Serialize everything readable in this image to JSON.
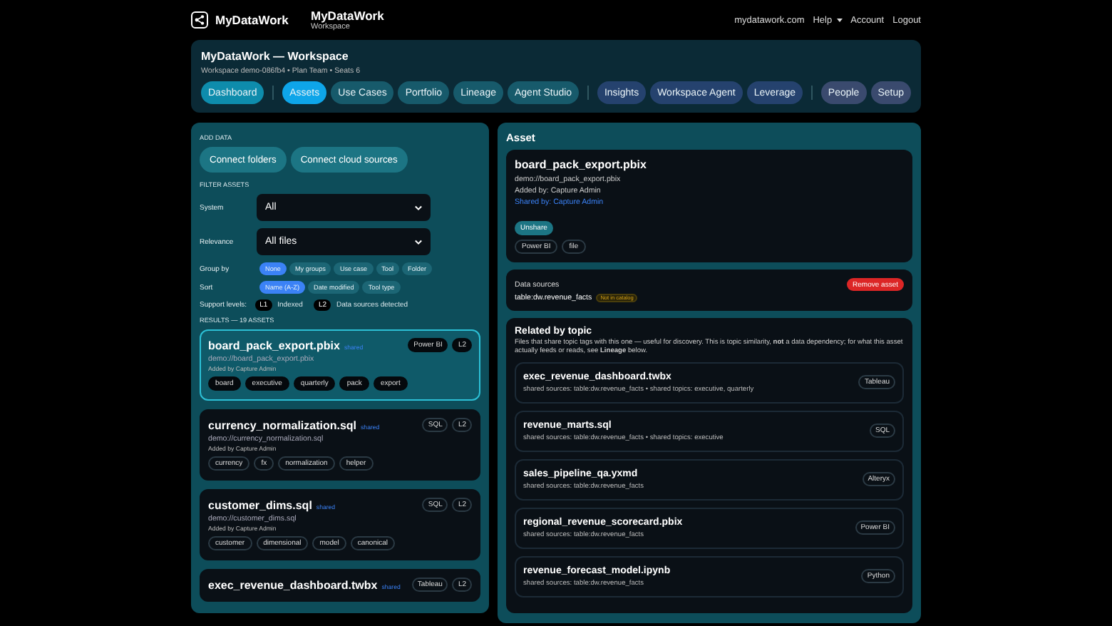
{
  "header": {
    "brand": "MyDataWork",
    "title": "MyDataWork",
    "subtitle": "Workspace",
    "links": [
      {
        "label": "mydatawork.com",
        "menu": false
      },
      {
        "label": "Help",
        "menu": true
      },
      {
        "label": "Account",
        "menu": false
      },
      {
        "label": "Logout",
        "menu": false
      }
    ]
  },
  "workspace": {
    "title": "MyDataWork — Workspace",
    "meta": "Workspace demo-086fb4 • Plan Team • Seats 6",
    "nav_groups": [
      {
        "kind": "home",
        "tabs": [
          {
            "label": "Dashboard",
            "selected": false
          }
        ]
      },
      {
        "kind": "build",
        "tabs": [
          {
            "label": "Assets",
            "selected": true
          },
          {
            "label": "Use Cases",
            "selected": false
          },
          {
            "label": "Portfolio",
            "selected": false
          },
          {
            "label": "Lineage",
            "selected": false
          },
          {
            "label": "Agent Studio",
            "selected": false
          }
        ]
      },
      {
        "kind": "analyze",
        "tabs": [
          {
            "label": "Insights",
            "selected": false
          },
          {
            "label": "Workspace Agent",
            "selected": false
          },
          {
            "label": "Leverage",
            "selected": false
          }
        ]
      },
      {
        "kind": "admin",
        "tabs": [
          {
            "label": "People",
            "selected": false
          },
          {
            "label": "Setup",
            "selected": false
          }
        ]
      }
    ]
  },
  "filters": {
    "add_heading": "ADD DATA",
    "add_buttons": [
      "Connect folders",
      "Connect cloud sources"
    ],
    "filter_heading": "FILTER ASSETS",
    "selects": [
      {
        "label": "System",
        "value": "All"
      },
      {
        "label": "Relevance",
        "value": "All files"
      }
    ],
    "group_by": {
      "label": "Group by",
      "options": [
        {
          "label": "None",
          "selected": true
        },
        {
          "label": "My groups",
          "selected": false
        },
        {
          "label": "Use case",
          "selected": false
        },
        {
          "label": "Tool",
          "selected": false
        },
        {
          "label": "Folder",
          "selected": false
        }
      ]
    },
    "sort": {
      "label": "Sort",
      "options": [
        {
          "label": "Name (A-Z)",
          "selected": true
        },
        {
          "label": "Date modified",
          "selected": false
        },
        {
          "label": "Tool type",
          "selected": false
        }
      ]
    },
    "support": {
      "label": "Support levels:",
      "levels": [
        {
          "badge": "L1",
          "text": "Indexed"
        },
        {
          "badge": "L2",
          "text": "Data sources detected"
        }
      ]
    },
    "results_heading": "RESULTS — 19 ASSETS"
  },
  "results": [
    {
      "name": "board_pack_export.pbix",
      "shared": "shared",
      "tool": "Power BI",
      "level": "L2",
      "path": "demo://board_pack_export.pbix",
      "added": "Added by Capture Admin",
      "tags": [
        "board",
        "executive",
        "quarterly",
        "pack",
        "export"
      ],
      "selected": true
    },
    {
      "name": "currency_normalization.sql",
      "shared": "shared",
      "tool": "SQL",
      "level": "L2",
      "path": "demo://currency_normalization.sql",
      "added": "Added by Capture Admin",
      "tags": [
        "currency",
        "fx",
        "normalization",
        "helper"
      ],
      "selected": false
    },
    {
      "name": "customer_dims.sql",
      "shared": "shared",
      "tool": "SQL",
      "level": "L2",
      "path": "demo://customer_dims.sql",
      "added": "Added by Capture Admin",
      "tags": [
        "customer",
        "dimensional",
        "model",
        "canonical"
      ],
      "selected": false
    },
    {
      "name": "exec_revenue_dashboard.twbx",
      "shared": "shared",
      "tool": "Tableau",
      "level": "L2",
      "selected": false
    }
  ],
  "asset": {
    "heading": "Asset",
    "name": "board_pack_export.pbix",
    "path": "demo://board_pack_export.pbix",
    "added": "Added by: Capture Admin",
    "shared_by": "Shared by: Capture Admin",
    "unshare": "Unshare",
    "tags": [
      "Power BI",
      "file"
    ],
    "sources_label": "Data sources",
    "remove": "Remove asset",
    "sources": [
      {
        "name": "table:dw.revenue_facts",
        "status": "Not in catalog"
      }
    ]
  },
  "related": {
    "heading": "Related by topic",
    "description": "Files that share topic tags with this one — useful for discovery. This is topic similarity, **not** a data dependency; for what this asset actually feeds or reads, see **Lineage** below.",
    "items": [
      {
        "name": "exec_revenue_dashboard.twbx",
        "meta": "shared sources: table:dw.revenue_facts • shared topics: executive, quarterly",
        "tool": "Tableau"
      },
      {
        "name": "revenue_marts.sql",
        "meta": "shared sources: table:dw.revenue_facts • shared topics: executive",
        "tool": "SQL"
      },
      {
        "name": "sales_pipeline_qa.yxmd",
        "meta": "shared sources: table:dw.revenue_facts",
        "tool": "Alteryx"
      },
      {
        "name": "regional_revenue_scorecard.pbix",
        "meta": "shared sources: table:dw.revenue_facts",
        "tool": "Power BI"
      },
      {
        "name": "revenue_forecast_model.ipynb",
        "meta": "shared sources: table:dw.revenue_facts",
        "tool": "Python"
      }
    ]
  }
}
